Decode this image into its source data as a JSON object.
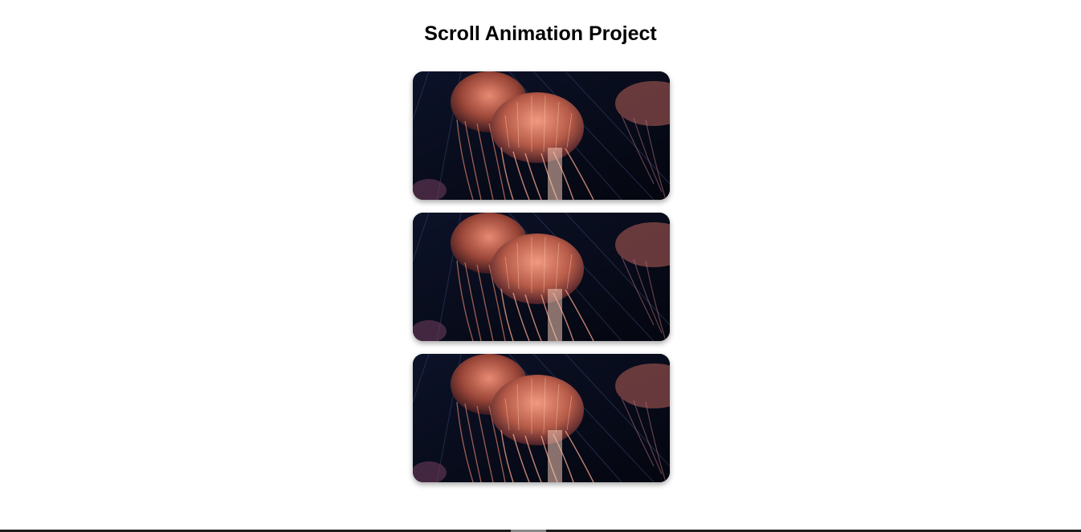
{
  "page": {
    "title": "Scroll Animation Project"
  },
  "cards": [
    {
      "image": "jellyfish-photo"
    },
    {
      "image": "jellyfish-photo"
    },
    {
      "image": "jellyfish-photo"
    }
  ],
  "colors": {
    "background": "#ffffff",
    "card_bg": "#06091a",
    "jelly_bell": "#c0604f",
    "jelly_tentacle": "#d98a78"
  }
}
